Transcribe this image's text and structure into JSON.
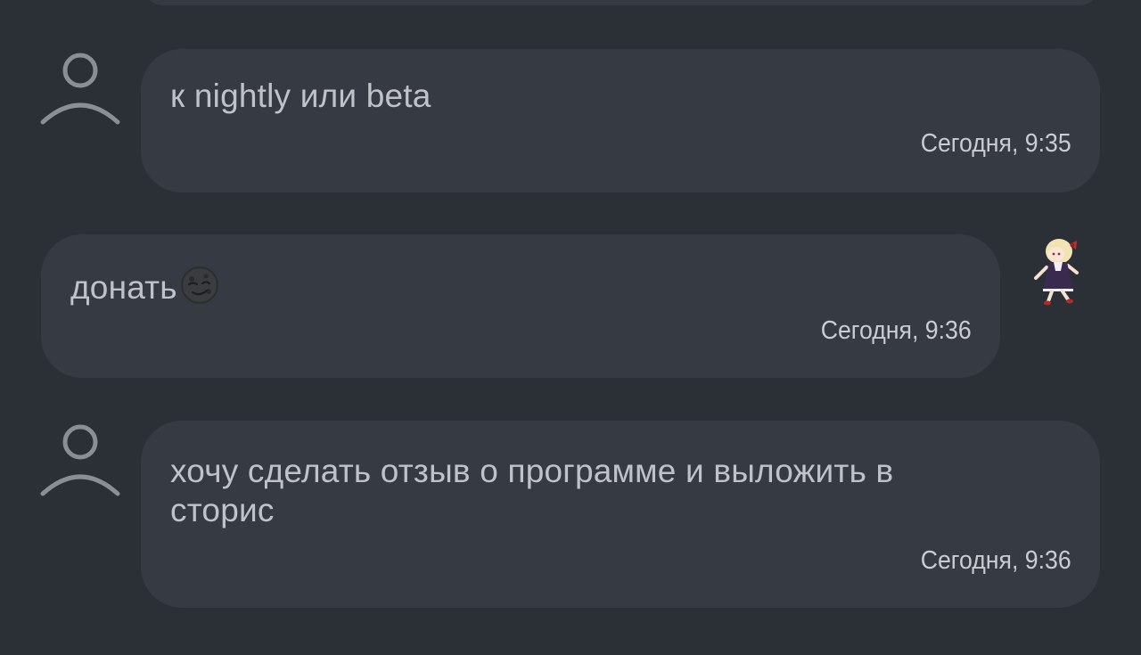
{
  "messages": [
    {
      "author": "other",
      "avatar_icon": "user-silhouette-icon",
      "text": "к nightly или beta",
      "time": "Сегодня, 9:35"
    },
    {
      "author": "self",
      "avatar_icon": "anime-girl-sticker-avatar",
      "text": "донать",
      "emoji": "smirking-dark-moon-emoji",
      "time": "Сегодня, 9:36"
    },
    {
      "author": "other",
      "avatar_icon": "user-silhouette-icon",
      "text": "хочу сделать отзыв о программе и выложить в\nсторис",
      "time": "Сегодня, 9:36"
    }
  ],
  "colors": {
    "background": "#2b2f36",
    "bubble": "#353a43",
    "text": "#bfc3c9",
    "avatar_outline": "#8a8e95"
  }
}
